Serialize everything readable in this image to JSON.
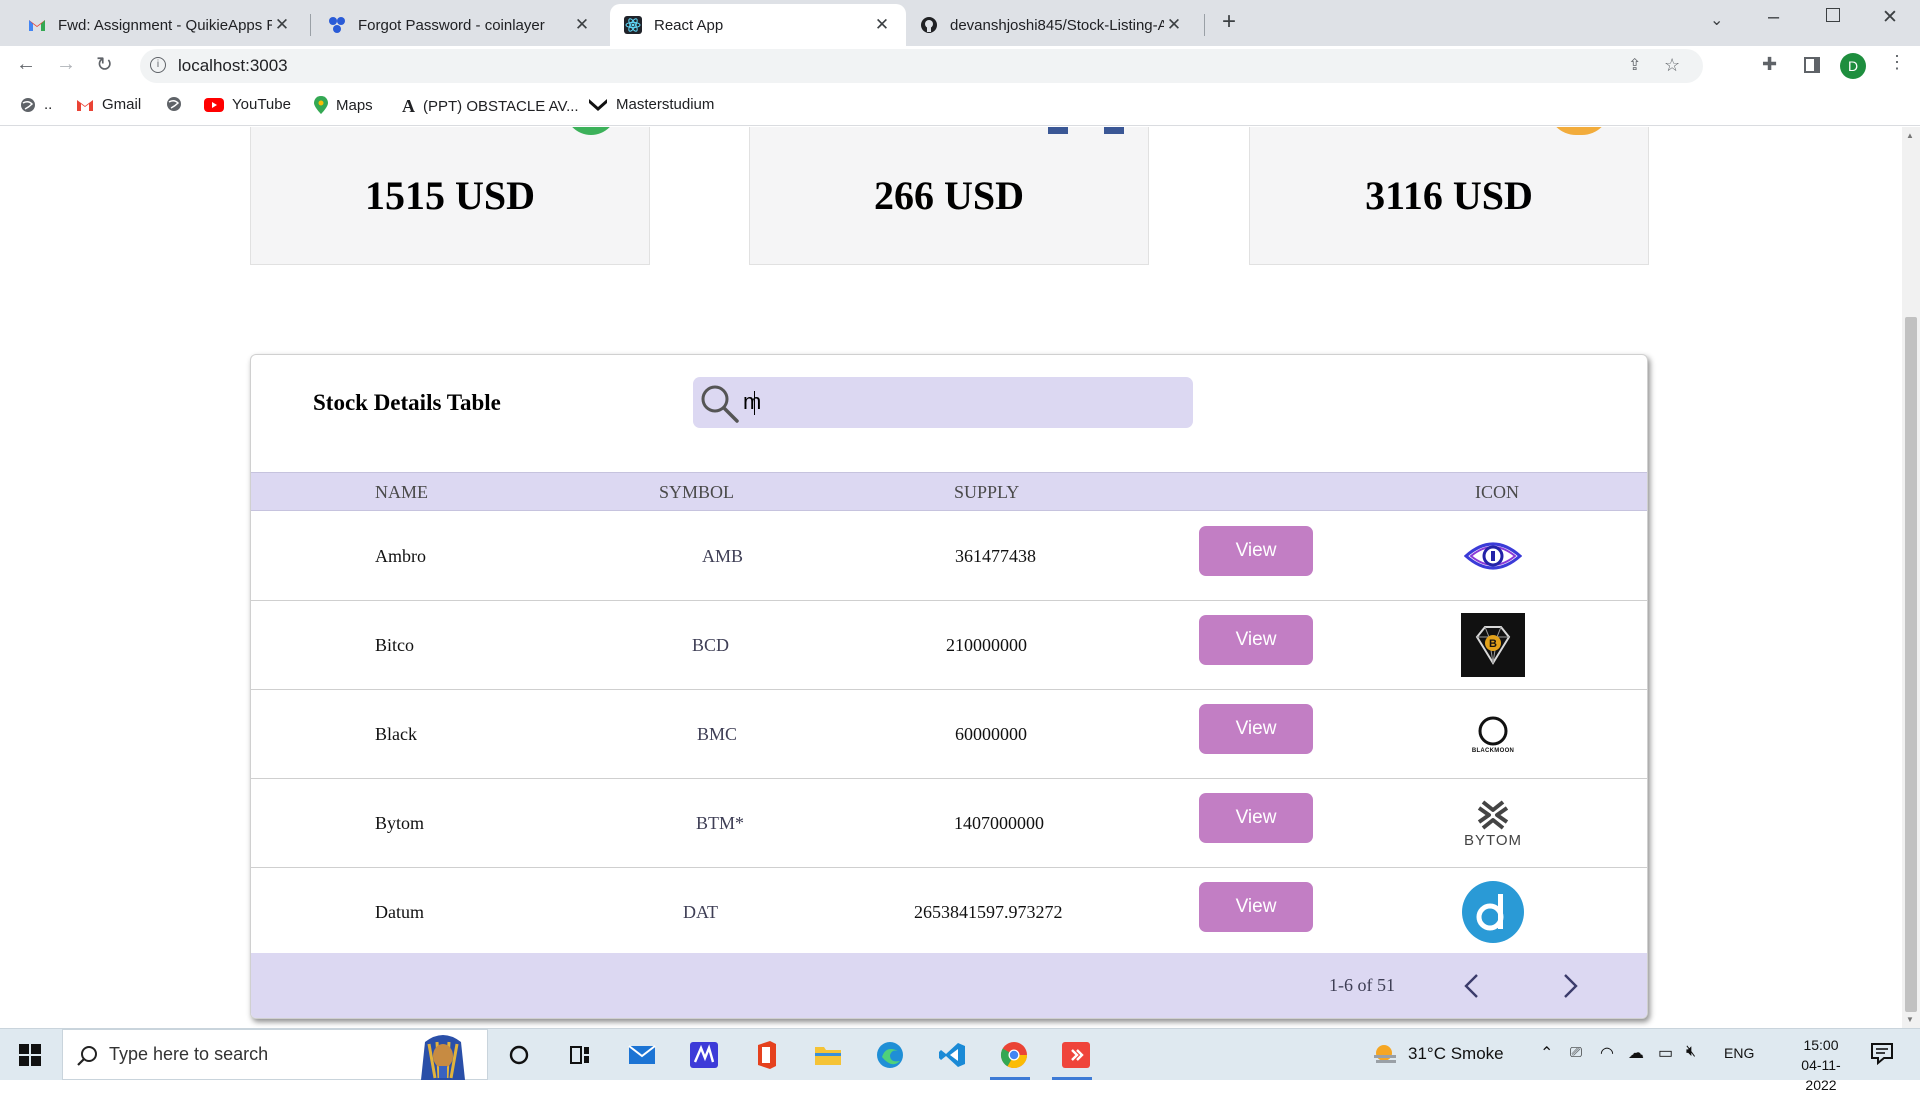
{
  "browser": {
    "tabs": [
      {
        "title": "Fwd: Assignment - QuikieApps R",
        "favicon": "gmail-icon",
        "active": false
      },
      {
        "title": "Forgot Password - coinlayer",
        "favicon": "coinlayer-icon",
        "active": false
      },
      {
        "title": "React App",
        "favicon": "react-icon",
        "active": true
      },
      {
        "title": "devanshjoshi845/Stock-Listing-A",
        "favicon": "github-icon",
        "active": false
      }
    ],
    "url": "localhost:3003",
    "profile_initial": "D",
    "bookmarks": [
      "..",
      "Gmail",
      "",
      "YouTube",
      "Maps",
      "(PPT) OBSTACLE AV...",
      "Masterstudium"
    ]
  },
  "cards": [
    {
      "value": "1515 USD"
    },
    {
      "value": "266 USD"
    },
    {
      "value": "3116 USD"
    }
  ],
  "table": {
    "title": "Stock Details Table",
    "search_value": "m",
    "columns": {
      "name": "NAME",
      "symbol": "SYMBOL",
      "supply": "SUPPLY",
      "icon": "ICON"
    },
    "view_label": "View",
    "rows": [
      {
        "name": "Ambro",
        "symbol": "AMB",
        "supply": "361477438",
        "icon": "eye-coin-icon"
      },
      {
        "name": "Bitco",
        "symbol": "BCD",
        "supply": "210000000",
        "icon": "bitcoin-diamond-icon"
      },
      {
        "name": "Black",
        "symbol": "BMC",
        "supply": "60000000",
        "icon": "blackmoon-icon",
        "logo_text": "BLACKMOON"
      },
      {
        "name": "Bytom",
        "symbol": "BTM*",
        "supply": "1407000000",
        "icon": "bytom-icon",
        "logo_text": "BYTOM"
      },
      {
        "name": "Datum",
        "symbol": "DAT",
        "supply": "2653841597.973272",
        "icon": "datum-icon"
      }
    ],
    "pagination": "1-6 of 51"
  },
  "taskbar": {
    "search_placeholder": "Type here to search",
    "weather": "31°C  Smoke",
    "lang": "ENG",
    "time": "15:00",
    "date": "04-11-2022"
  }
}
